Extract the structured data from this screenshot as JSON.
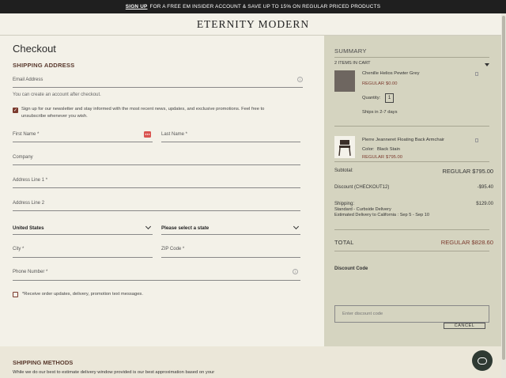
{
  "promo": {
    "link": "SIGN UP",
    "text": "FOR A FREE EM INSIDER ACCOUNT & SAVE UP TO 15% ON REGULAR PRICED PRODUCTS"
  },
  "brand": {
    "name": "ETERNITY MODERN"
  },
  "checkout": {
    "title": "Checkout",
    "shipping_heading": "SHIPPING ADDRESS",
    "email_label": "Email Address",
    "email_hint": "You can create an account after checkout.",
    "newsletter_text": "Sign up for our newsletter and stay informed with the most recent news, updates, and exclusive promotions. Feel free to unsubscribe whenever you wish.",
    "first_name_label": "First Name *",
    "last_name_label": "Last Name *",
    "company_label": "Company",
    "address1_label": "Address Line 1 *",
    "address2_label": "Address Line 2",
    "country_value": "United States",
    "state_value": "Please select a state",
    "city_label": "City *",
    "zip_label": "ZIP Code *",
    "phone_label": "Phone Number *",
    "sms_text": "*Receive order updates, delivery, promotion text messages.",
    "shipping_methods_heading": "SHIPPING METHODS",
    "shipping_methods_text": "While we do our best to estimate delivery window provided is our best approximation based on your"
  },
  "summary": {
    "title": "SUMMARY",
    "items_count": "2  ITEMS IN CART",
    "items": [
      {
        "name": "Chenille Helios Pewter Grey",
        "price_tag": "REGULAR",
        "price": "$0.00",
        "qty_label": "Quantity:",
        "qty": "1",
        "ship_time": "Ships in 2-7 days"
      },
      {
        "name": "Pierre Jeanneret Floating Back Armchair",
        "color_label": "Color:",
        "color": "Black Stain",
        "price_tag": "REGULAR",
        "price": "$795.00"
      }
    ],
    "subtotal_label": "Subtotal:",
    "subtotal_value": "REGULAR $795.00",
    "discount_label": "Discount (CHECKOUT12)",
    "discount_value": "-$95.40",
    "shipping_label": "Shipping:",
    "shipping_value": "$129.00",
    "shipping_method": "Standard - Curbside Delivery",
    "delivery_estimate_prefix": "Estimated Delivery to California : ",
    "delivery_estimate_dates": "Sep 5 - Sep 10",
    "total_label": "TOTAL",
    "total_value": "REGULAR $828.60",
    "discount_code_heading": "Discount Code",
    "discount_placeholder": "Enter discount code",
    "cancel_label": "CANCEL"
  },
  "colors": {
    "accent": "#7b3a2d",
    "summary_bg": "#d5d4c0",
    "page_bg": "#f3f1e8"
  }
}
